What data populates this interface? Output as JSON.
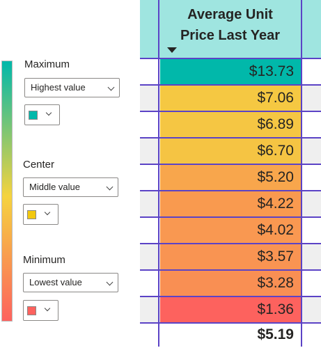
{
  "legend": {
    "maximum": {
      "label": "Maximum",
      "dropdown": "Highest value",
      "color": "#01b8aa"
    },
    "center": {
      "label": "Center",
      "dropdown": "Middle value",
      "color": "#f2c80f"
    },
    "minimum": {
      "label": "Minimum",
      "dropdown": "Lowest value",
      "color": "#fd625e"
    }
  },
  "table": {
    "header": "Average Unit\nPrice Last Year",
    "rows": [
      {
        "value": "$13.73",
        "color": "#01b8aa"
      },
      {
        "value": "$7.06",
        "color": "#f5c842"
      },
      {
        "value": "$6.89",
        "color": "#f5c643"
      },
      {
        "value": "$6.70",
        "color": "#f5c443"
      },
      {
        "value": "$5.20",
        "color": "#f8a64c"
      },
      {
        "value": "$4.22",
        "color": "#f99a4f"
      },
      {
        "value": "$4.02",
        "color": "#f99851"
      },
      {
        "value": "$3.57",
        "color": "#f99452"
      },
      {
        "value": "$3.28",
        "color": "#f98f53"
      },
      {
        "value": "$1.36",
        "color": "#fd625e"
      }
    ],
    "total": "$5.19"
  }
}
